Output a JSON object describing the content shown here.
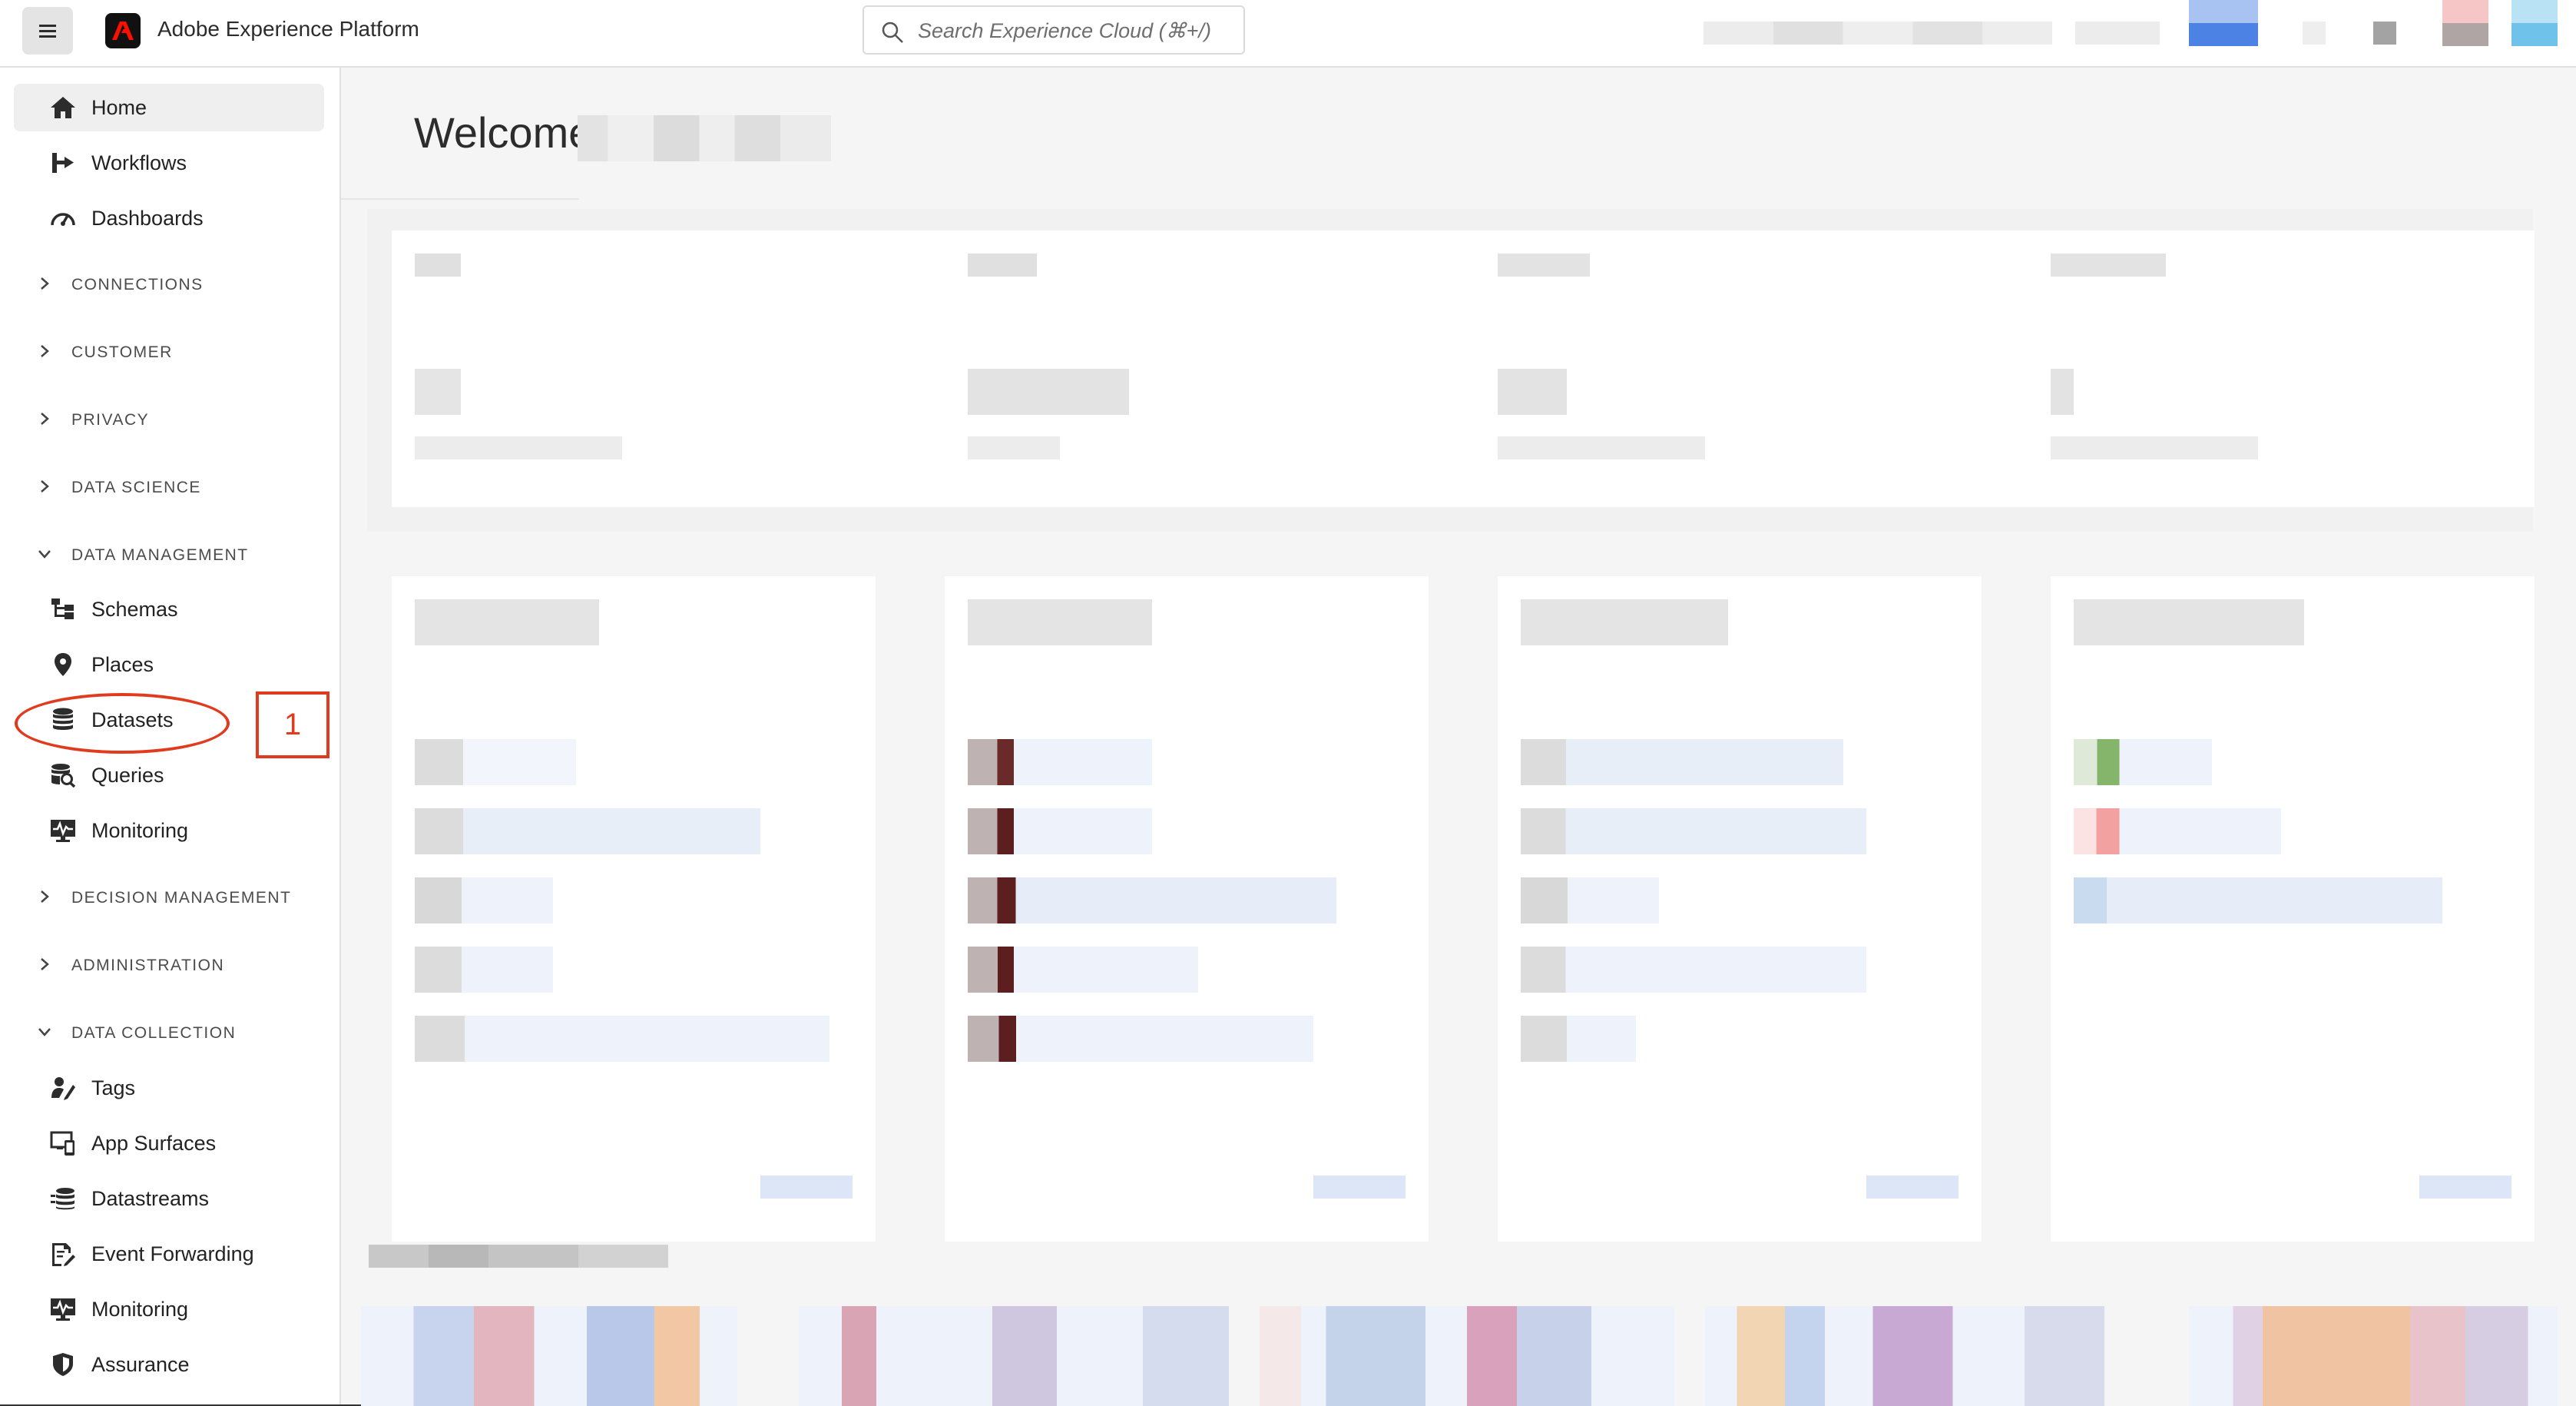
{
  "header": {
    "app_title": "Adobe Experience Platform",
    "search_placeholder": "Search Experience Cloud (⌘+/)"
  },
  "sidebar": {
    "items": [
      {
        "label": "Home",
        "icon": "home-icon",
        "active": true
      },
      {
        "label": "Workflows",
        "icon": "workflows-icon"
      },
      {
        "label": "Dashboards",
        "icon": "dashboards-icon"
      }
    ],
    "sections": [
      {
        "label": "CONNECTIONS",
        "expanded": false
      },
      {
        "label": "CUSTOMER",
        "expanded": false
      },
      {
        "label": "PRIVACY",
        "expanded": false
      },
      {
        "label": "DATA SCIENCE",
        "expanded": false
      },
      {
        "label": "DATA MANAGEMENT",
        "expanded": true
      },
      {
        "label": "DECISION MANAGEMENT",
        "expanded": false
      },
      {
        "label": "ADMINISTRATION",
        "expanded": false
      },
      {
        "label": "DATA COLLECTION",
        "expanded": true
      }
    ],
    "data_management": [
      {
        "label": "Schemas",
        "icon": "schemas-icon"
      },
      {
        "label": "Places",
        "icon": "places-icon"
      },
      {
        "label": "Datasets",
        "icon": "datasets-icon"
      },
      {
        "label": "Queries",
        "icon": "queries-icon"
      },
      {
        "label": "Monitoring",
        "icon": "monitoring-icon"
      }
    ],
    "data_collection": [
      {
        "label": "Tags",
        "icon": "tags-icon"
      },
      {
        "label": "App Surfaces",
        "icon": "app-surfaces-icon"
      },
      {
        "label": "Datastreams",
        "icon": "datastreams-icon"
      },
      {
        "label": "Event Forwarding",
        "icon": "event-forwarding-icon"
      },
      {
        "label": "Monitoring",
        "icon": "monitoring-icon"
      },
      {
        "label": "Assurance",
        "icon": "assurance-icon"
      }
    ]
  },
  "main": {
    "welcome": "Welcome"
  },
  "annotation": {
    "step": "1",
    "color": "#e03b1f"
  }
}
